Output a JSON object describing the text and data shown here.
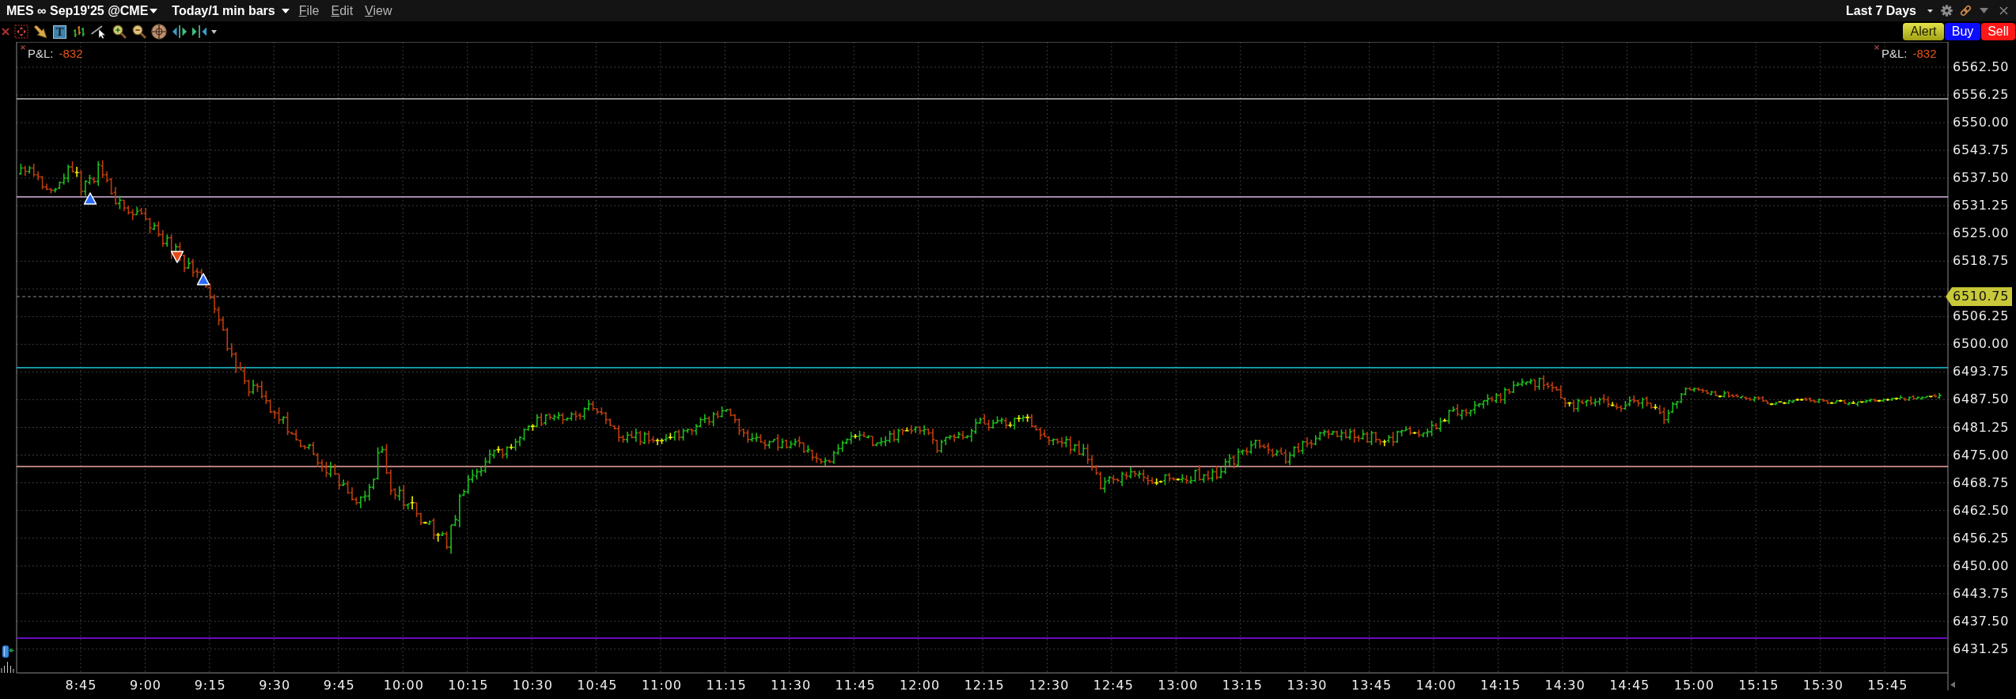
{
  "title_bar": {
    "instrument": "MES ∞ Sep19'25 @CME",
    "period": "Today/1 min bars",
    "menus": [
      "File",
      "Edit",
      "View"
    ],
    "range": "Last 7 Days"
  },
  "toolbar": {
    "text_tool": "T"
  },
  "order_buttons": [
    {
      "label": "Alert",
      "kind": "alert"
    },
    {
      "label": "Buy",
      "kind": "buy"
    },
    {
      "label": "Sell",
      "kind": "sell"
    }
  ],
  "chart": {
    "pnl": [
      {
        "label": "P&L:",
        "value": "-832"
      },
      {
        "label": "P&L:",
        "value": "-832"
      }
    ],
    "price_axis": {
      "upper_labels": [
        "6562.50",
        "6556.25",
        "6550.00",
        "6543.75",
        "6537.50",
        "6531.25",
        "6525.00",
        "6518.75"
      ],
      "current_price": "6510.75",
      "lower_labels": [
        "6506.25",
        "6500.00",
        "6493.75",
        "6487.50",
        "6481.25",
        "6475.00",
        "6468.75",
        "6462.50",
        "6456.25",
        "6450.00",
        "6443.75",
        "6437.50",
        "6431.25"
      ]
    },
    "time_axis": {
      "labels": [
        "8:45",
        "9:00",
        "9:15",
        "9:30",
        "9:45",
        "10:00",
        "10:15",
        "10:30",
        "10:45",
        "11:00",
        "11:15",
        "11:30",
        "11:45",
        "12:00",
        "12:15",
        "12:30",
        "12:45",
        "13:00",
        "13:15",
        "13:30",
        "13:45",
        "14:00",
        "14:15",
        "14:30",
        "14:45",
        "15:00",
        "15:15",
        "15:30",
        "15:45"
      ]
    }
  }
}
